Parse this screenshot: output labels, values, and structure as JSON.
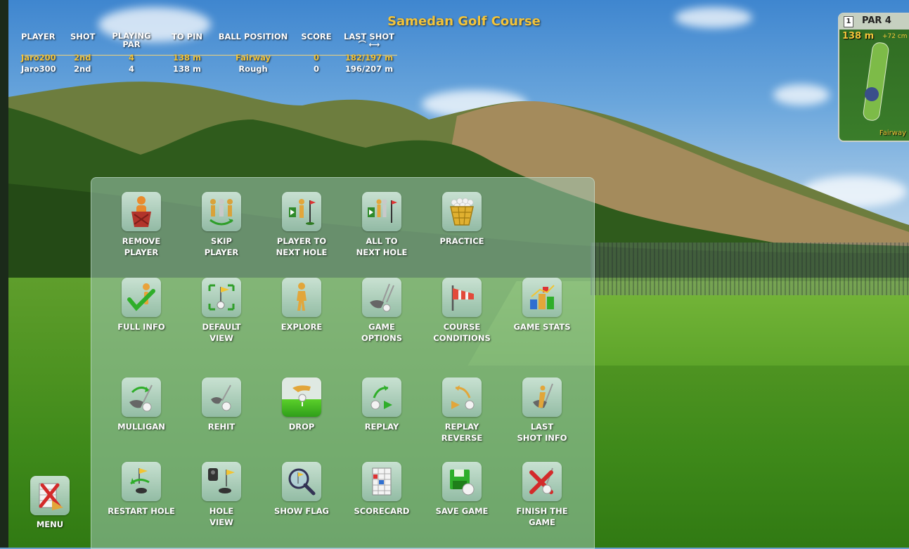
{
  "course_title": "Samedan Golf Course",
  "scoreboard": {
    "headers": {
      "player": "PLAYER",
      "shot": "SHOT",
      "playing_par": "PLAYING\nPAR",
      "to_pin": "TO PIN",
      "ball_position": "BALL POSITION",
      "score": "SCORE",
      "last_shot": "LAST SHOT",
      "last_shot_symbols": "⌒ ⟷"
    },
    "rows": [
      {
        "player": "Jaro200",
        "shot": "2nd",
        "par": "4",
        "to_pin": "138 m",
        "position": "Fairway",
        "score": "0",
        "last_shot": "182/197 m",
        "active": true
      },
      {
        "player": "Jaro300",
        "shot": "2nd",
        "par": "4",
        "to_pin": "138 m",
        "position": "Rough",
        "score": "0",
        "last_shot": "196/207 m",
        "active": false
      }
    ]
  },
  "minimap": {
    "hole": "1",
    "par": "PAR 4",
    "distance": "138 m",
    "elevation": "+72 cm",
    "lie": "Fairway"
  },
  "menu": {
    "items": [
      {
        "label": "REMOVE\nPLAYER",
        "icon": "remove-player-icon"
      },
      {
        "label": "SKIP\nPLAYER",
        "icon": "skip-player-icon"
      },
      {
        "label": "PLAYER TO\nNEXT HOLE",
        "icon": "player-next-hole-icon"
      },
      {
        "label": "ALL TO\nNEXT HOLE",
        "icon": "all-next-hole-icon"
      },
      {
        "label": "PRACTICE",
        "icon": "practice-basket-icon"
      },
      {
        "label": "FULL INFO",
        "icon": "full-info-icon"
      },
      {
        "label": "DEFAULT\nVIEW",
        "icon": "default-view-icon"
      },
      {
        "label": "EXPLORE",
        "icon": "explore-icon"
      },
      {
        "label": "GAME\nOPTIONS",
        "icon": "game-options-icon"
      },
      {
        "label": "COURSE\nCONDITIONS",
        "icon": "windsock-icon"
      },
      {
        "label": "GAME STATS",
        "icon": "game-stats-icon"
      },
      {
        "label": "MULLIGAN",
        "icon": "mulligan-icon"
      },
      {
        "label": "REHIT",
        "icon": "rehit-icon"
      },
      {
        "label": "DROP",
        "icon": "drop-icon"
      },
      {
        "label": "REPLAY",
        "icon": "replay-icon"
      },
      {
        "label": "REPLAY\nREVERSE",
        "icon": "replay-reverse-icon"
      },
      {
        "label": "LAST\nSHOT INFO",
        "icon": "last-shot-info-icon"
      },
      {
        "label": "RESTART HOLE",
        "icon": "restart-hole-icon"
      },
      {
        "label": "HOLE\nVIEW",
        "icon": "hole-view-icon"
      },
      {
        "label": "SHOW FLAG",
        "icon": "show-flag-icon"
      },
      {
        "label": "SCORECARD",
        "icon": "scorecard-icon"
      },
      {
        "label": "SAVE GAME",
        "icon": "save-game-icon"
      },
      {
        "label": "FINISH THE GAME",
        "icon": "finish-game-icon"
      }
    ],
    "menu_button": "MENU"
  },
  "colors": {
    "accent": "#f3c43a",
    "panel": "#a0c8b4",
    "text": "#ffffff"
  }
}
